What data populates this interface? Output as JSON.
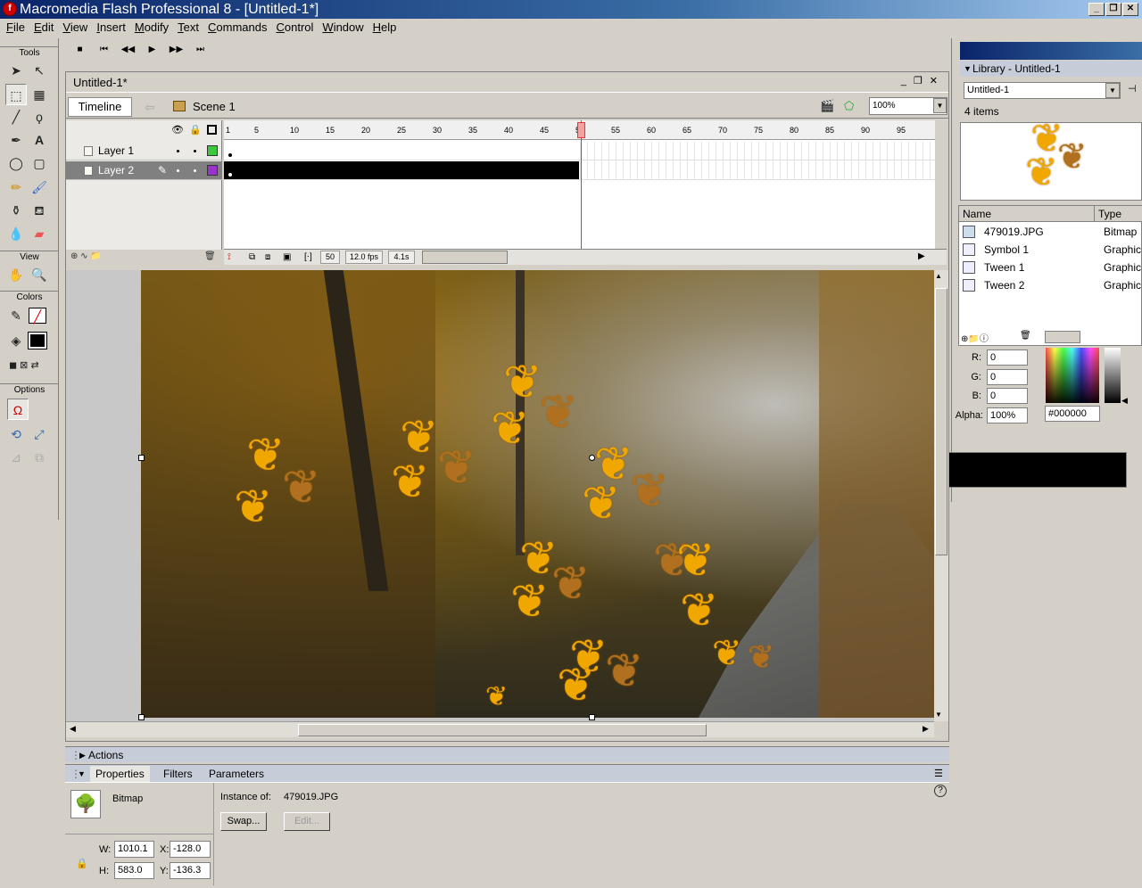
{
  "window": {
    "title": "Macromedia Flash Professional 8 - [Untitled-1*]",
    "buttons": {
      "minimize": "_",
      "restore": "❐",
      "close": "✕"
    }
  },
  "menu": [
    "File",
    "Edit",
    "View",
    "Insert",
    "Modify",
    "Text",
    "Commands",
    "Control",
    "Window",
    "Help"
  ],
  "controller": {
    "stop": "■",
    "rewind": "⏮",
    "step_back": "◀◀",
    "play": "▶",
    "step_fwd": "▶▶",
    "end": "⏭"
  },
  "tools": {
    "header": "Tools",
    "view_header": "View",
    "colors_header": "Colors",
    "options_header": "Options"
  },
  "document": {
    "tab_title": "Untitled-1*",
    "timeline_button": "Timeline",
    "scene_label": "Scene 1",
    "zoom": "100%"
  },
  "timeline": {
    "layers": [
      {
        "name": "Layer 1",
        "color": "#3cc83c",
        "selected": false
      },
      {
        "name": "Layer 2",
        "color": "#9933cc",
        "selected": true
      }
    ],
    "ruler": [
      "1",
      "5",
      "10",
      "15",
      "20",
      "25",
      "30",
      "35",
      "40",
      "45",
      "50",
      "55",
      "60",
      "65",
      "70",
      "75",
      "80",
      "85",
      "90",
      "95"
    ],
    "current_frame": "50",
    "frame_rate": "12.0 fps",
    "elapsed": "4.1s"
  },
  "panels": {
    "actions_title": "Actions",
    "properties_tabs": [
      "Properties",
      "Filters",
      "Parameters"
    ]
  },
  "properties": {
    "type": "Bitmap",
    "instance_label": "Instance of:",
    "instance_value": "479019.JPG",
    "swap_button": "Swap...",
    "edit_button": "Edit...",
    "w_label": "W:",
    "w_value": "1010.1",
    "h_label": "H:",
    "h_value": "583.0",
    "x_label": "X:",
    "x_value": "-128.0",
    "y_label": "Y:",
    "y_value": "-136.3"
  },
  "library": {
    "title": "Library - Untitled-1",
    "doc_select": "Untitled-1",
    "item_count": "4 items",
    "columns": [
      "Name",
      "Type"
    ],
    "items": [
      {
        "name": "479019.JPG",
        "type": "Bitmap"
      },
      {
        "name": "Symbol 1",
        "type": "Graphic"
      },
      {
        "name": "Tween 1",
        "type": "Graphic"
      },
      {
        "name": "Tween 2",
        "type": "Graphic"
      }
    ]
  },
  "color_mixer": {
    "r_label": "R:",
    "r_value": "0",
    "g_label": "G:",
    "g_value": "0",
    "b_label": "B:",
    "b_value": "0",
    "alpha_label": "Alpha:",
    "alpha_value": "100%",
    "hex": "#000000"
  },
  "colors": {
    "accent": "#0a246a",
    "playhead": "#ee3333",
    "fill": "#000000"
  }
}
